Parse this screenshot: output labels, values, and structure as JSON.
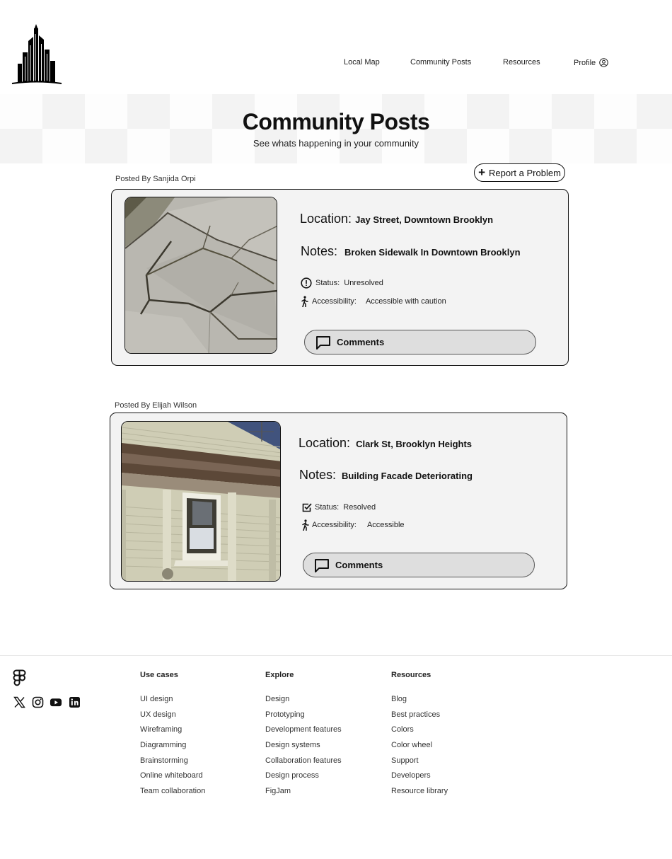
{
  "nav": {
    "items": [
      "Local Map",
      "Community Posts",
      "Resources",
      "Profile"
    ]
  },
  "hero": {
    "title": "Community Posts",
    "subtitle": "See whats happening in your community"
  },
  "report_button": "Report a Problem",
  "labels": {
    "location": "Location:",
    "notes": "Notes:",
    "status": "Status:",
    "accessibility": "Accessibility:",
    "comments": "Comments"
  },
  "posts": [
    {
      "posted_by": "Posted By Sanjida Orpi",
      "location": "Jay Street, Downtown Brooklyn",
      "notes": "Broken Sidewalk In Downtown Brooklyn",
      "status": "Unresolved",
      "status_icon": "alert-circle-icon",
      "accessibility": "Accessible with caution"
    },
    {
      "posted_by": "Posted By Elijah Wilson",
      "location": "Clark St, Brooklyn Heights",
      "notes": "Building Facade Deteriorating",
      "status": "Resolved",
      "status_icon": "check-square-icon",
      "accessibility": "Accessible"
    }
  ],
  "footer": {
    "columns": [
      {
        "title": "Use cases",
        "links": [
          "UI design",
          "UX design",
          "Wireframing",
          "Diagramming",
          "Brainstorming",
          "Online whiteboard",
          "Team collaboration"
        ]
      },
      {
        "title": "Explore",
        "links": [
          "Design",
          "Prototyping",
          "Development features",
          "Design systems",
          "Collaboration features",
          "Design process",
          "FigJam"
        ]
      },
      {
        "title": "Resources",
        "links": [
          "Blog",
          "Best practices",
          "Colors",
          "Color wheel",
          "Support",
          "Developers",
          "Resource library"
        ]
      }
    ],
    "socials": [
      "x-icon",
      "instagram-icon",
      "youtube-icon",
      "linkedin-icon"
    ]
  }
}
